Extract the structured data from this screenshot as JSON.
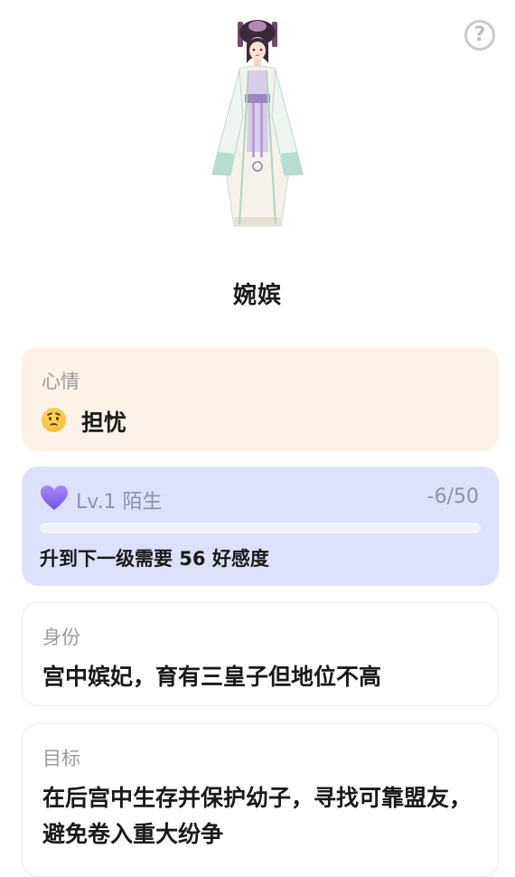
{
  "help": {
    "icon": "question-circle-icon",
    "glyph": "?"
  },
  "character": {
    "name": "婉嫔"
  },
  "mood": {
    "label": "心情",
    "emoji_icon": "worried-face-icon",
    "value": "担忧"
  },
  "affinity": {
    "icon": "purple-heart-icon",
    "level": "Lv.1 陌生",
    "count": "-6/50",
    "progress": 0,
    "hint": "升到下一级需要 56 好感度",
    "accent_color": "#8b6ff0"
  },
  "identity": {
    "label": "身份",
    "value": "宫中嫔妃，育有三皇子但地位不高"
  },
  "goal": {
    "label": "目标",
    "value": "在后宫中生存并保护幼子，寻找可靠盟友，避免卷入重大纷争"
  }
}
